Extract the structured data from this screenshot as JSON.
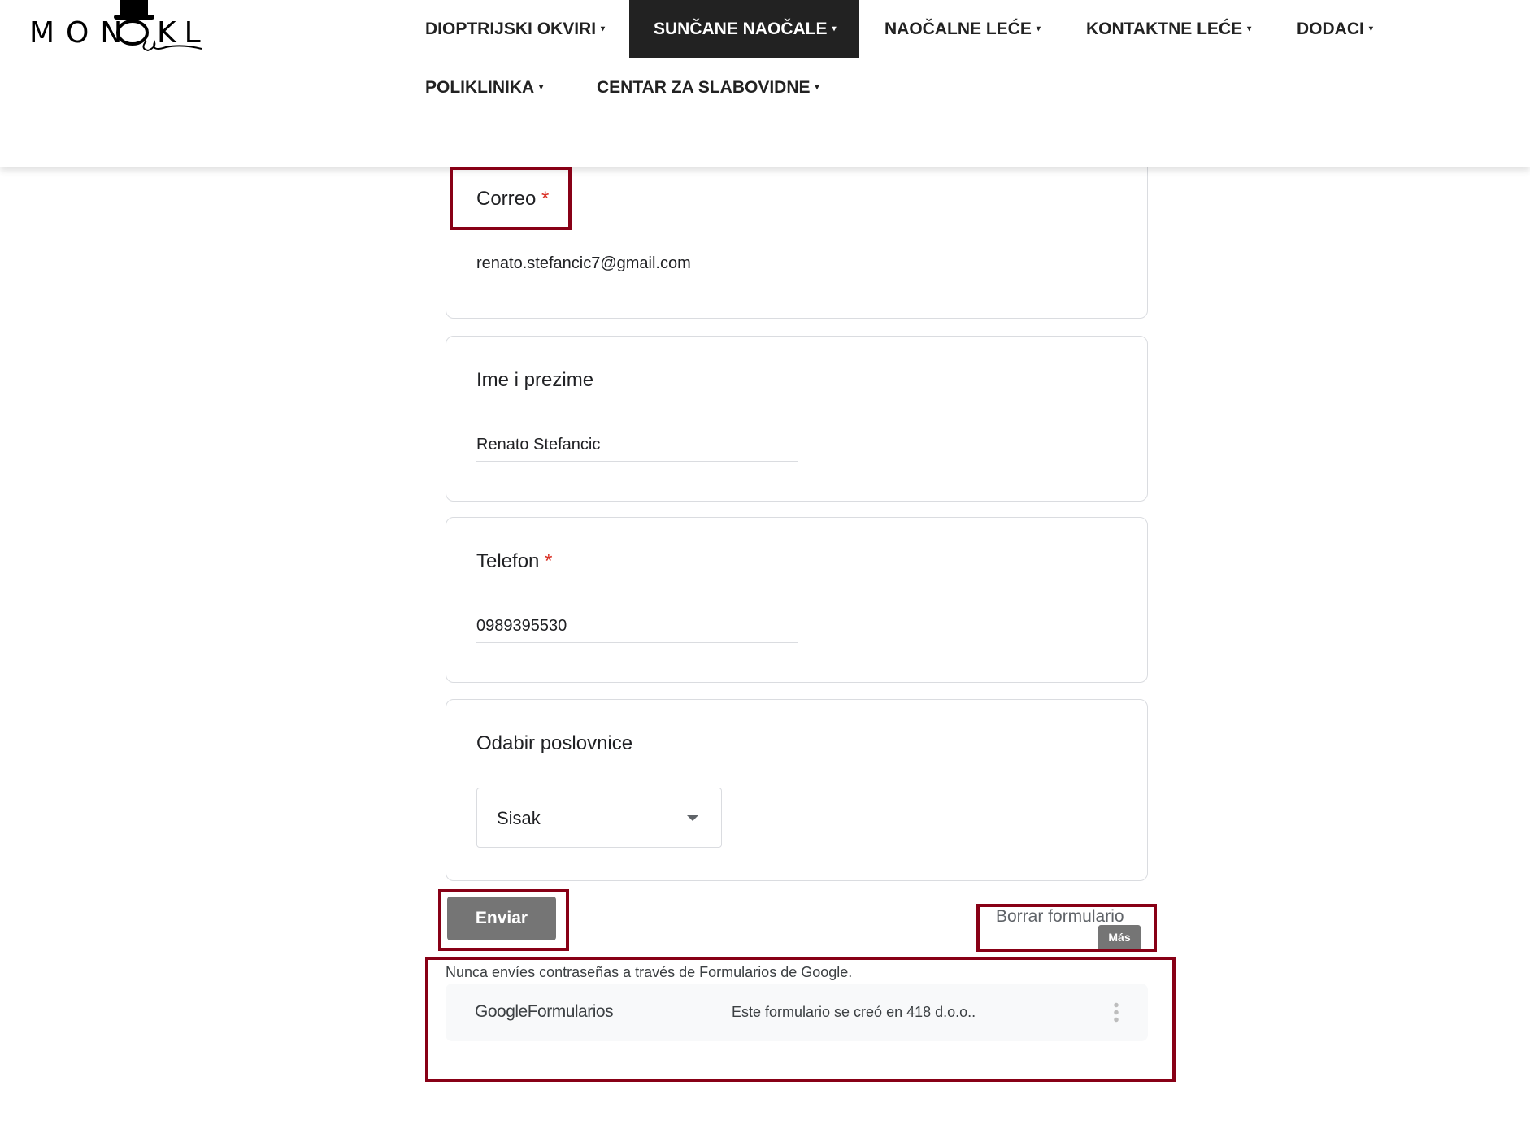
{
  "logo": {
    "text": "MONOKL"
  },
  "nav": [
    {
      "label": "DIOPTRIJSKI OKVIRI",
      "active": false
    },
    {
      "label": "SUNČANE NAOČALE",
      "active": true
    },
    {
      "label": "NAOČALNE LEĆE",
      "active": false
    },
    {
      "label": "KONTAKTNE LEĆE",
      "active": false
    },
    {
      "label": "DODACI",
      "active": false
    },
    {
      "label": "POLIKLINIKA",
      "active": false
    },
    {
      "label": "CENTAR ZA SLABOVIDNE",
      "active": false
    }
  ],
  "caret": "▾",
  "form": {
    "email": {
      "label": "Correo",
      "required": "*",
      "value": "renato.stefancic7@gmail.com"
    },
    "name": {
      "label": "Ime i prezime",
      "value": "Renato Stefancic"
    },
    "phone": {
      "label": "Telefon",
      "required": "*",
      "value": "0989395530"
    },
    "branch": {
      "label": "Odabir poslovnice",
      "value": "Sisak"
    },
    "submit": "Enviar",
    "clear": "Borrar formulario",
    "more_tooltip": "Más"
  },
  "footer": {
    "warning": "Nunca envíes contraseñas a través de Formularios de Google.",
    "brand_google": "Google",
    "brand_forms": "Formularios",
    "created": "Este formulario se creó en 418 d.o.o.."
  },
  "colors": {
    "highlight": "#880016",
    "active_nav": "#222222",
    "button": "#757575"
  }
}
